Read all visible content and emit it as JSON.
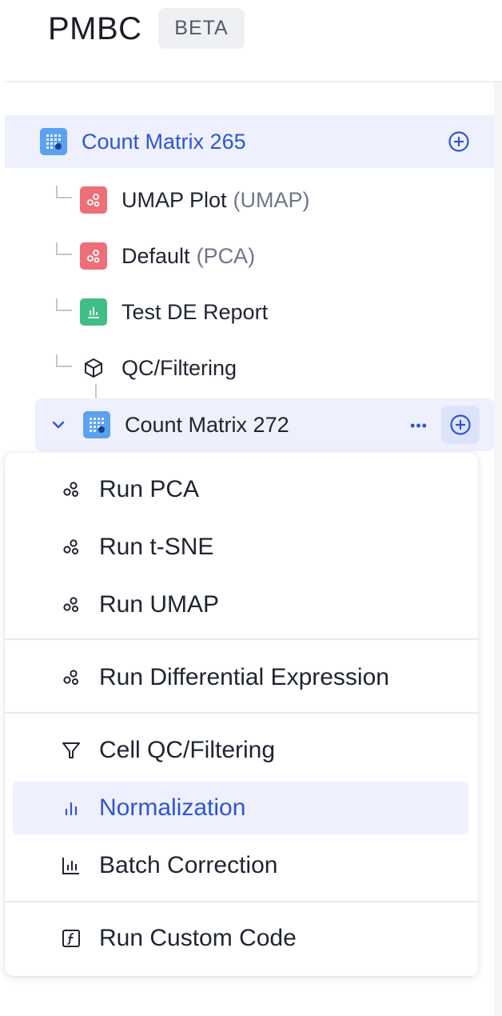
{
  "app": {
    "title": "PMBC",
    "badge": "BETA"
  },
  "tree": {
    "root": {
      "label": "Count Matrix 265"
    },
    "children": [
      {
        "label": "UMAP Plot",
        "sub": "(UMAP)",
        "icon": "scatter-icon",
        "color": "#ef6f78"
      },
      {
        "label": "Default",
        "sub": "(PCA)",
        "icon": "scatter-icon",
        "color": "#ef6f78"
      },
      {
        "label": "Test DE Report",
        "sub": "",
        "icon": "bar-chart-icon",
        "color": "#3fbf86"
      },
      {
        "label": "QC/Filtering",
        "sub": "",
        "icon": "cube-icon",
        "color": ""
      }
    ],
    "selected": {
      "label": "Count Matrix 272",
      "more": "•••"
    }
  },
  "menu": {
    "items": [
      {
        "label": "Run PCA",
        "icon": "scatter-icon"
      },
      {
        "label": "Run t-SNE",
        "icon": "scatter-icon"
      },
      {
        "label": "Run UMAP",
        "icon": "scatter-icon"
      },
      {
        "label": "Run Differential Expression",
        "icon": "scatter-icon"
      },
      {
        "label": "Cell QC/Filtering",
        "icon": "filter-icon"
      },
      {
        "label": "Normalization",
        "icon": "bars-icon",
        "active": true
      },
      {
        "label": "Batch Correction",
        "icon": "bar-chart-outline-icon"
      },
      {
        "label": "Run Custom Code",
        "icon": "function-icon"
      }
    ]
  },
  "colors": {
    "accent": "#2f55d4",
    "selected_bg": "#eef0fd",
    "matrix_tile": "#5aa2ef"
  }
}
